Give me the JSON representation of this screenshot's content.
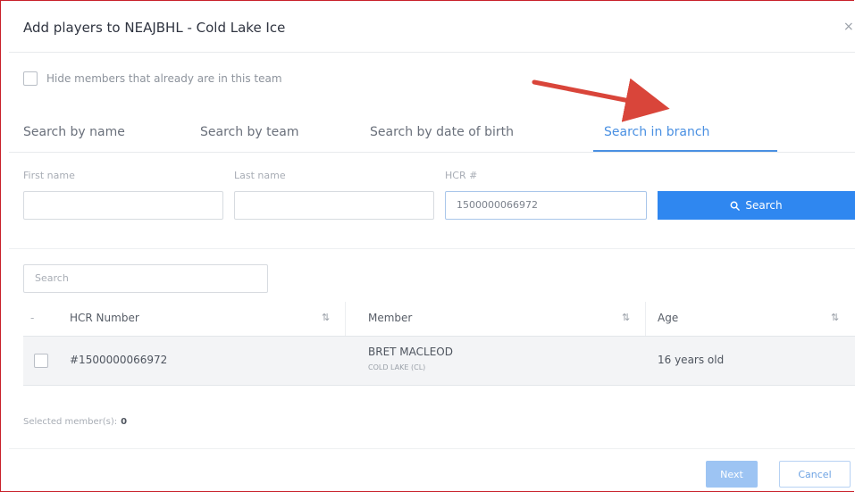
{
  "dialog": {
    "title": "Add players to NEAJBHL - Cold Lake Ice",
    "close_label": "×"
  },
  "filter": {
    "hide_members_label": "Hide members that already are in this team",
    "hide_members_checked": false
  },
  "tabs": [
    {
      "label": "Search by name",
      "active": false
    },
    {
      "label": "Search by team",
      "active": false
    },
    {
      "label": "Search by date of birth",
      "active": false
    },
    {
      "label": "Search in branch",
      "active": true
    }
  ],
  "search_form": {
    "first_name_label": "First name",
    "first_name_value": "",
    "last_name_label": "Last name",
    "last_name_value": "",
    "hcr_label": "HCR #",
    "hcr_value": "1500000066972",
    "search_button_label": "Search"
  },
  "results": {
    "search_placeholder": "Search",
    "columns": [
      {
        "label": "HCR Number",
        "sort_icon": "⇅"
      },
      {
        "label": "Member",
        "sort_icon": "⇅"
      },
      {
        "label": "Age",
        "sort_icon": "⇅"
      }
    ],
    "rows": [
      {
        "hcr_number": "#1500000066972",
        "member_name": "BRET MACLEOD",
        "member_team": "COLD LAKE (CL)",
        "age": "16 years old"
      }
    ]
  },
  "selection": {
    "label": "Selected member(s):",
    "count": "0"
  },
  "footer": {
    "next_label": "Next",
    "cancel_label": "Cancel"
  },
  "colors": {
    "accent": "#2f87f0",
    "active_tab": "#4a90e2",
    "annotation_arrow": "#d9453a",
    "frame_border": "#c8202a"
  }
}
